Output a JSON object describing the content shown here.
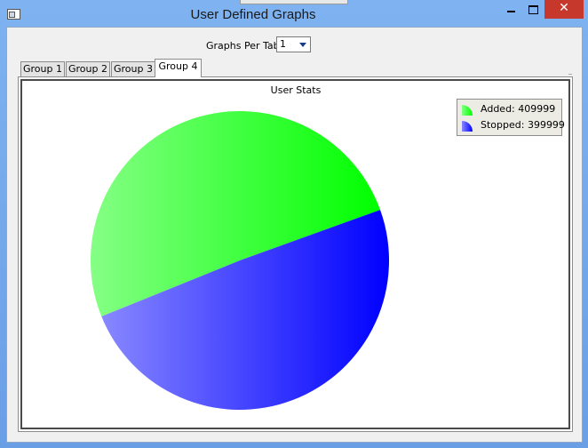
{
  "window": {
    "title": "User Defined Graphs",
    "close_glyph": "✕",
    "icons": {
      "app": "window-app-icon",
      "minimize": "minimize-icon",
      "maximize": "maximize-icon",
      "close": "close-icon"
    }
  },
  "controls": {
    "graphs_per_tab_label": "Graphs Per Tab",
    "graphs_per_tab_value": "1"
  },
  "tabs": [
    {
      "label": "Group 1",
      "active": false
    },
    {
      "label": "Group 2",
      "active": false
    },
    {
      "label": "Group 3",
      "active": false
    },
    {
      "label": "Group 4",
      "active": true
    }
  ],
  "chart_data": {
    "type": "pie",
    "title": "User Stats",
    "series": [
      {
        "name": "Added",
        "value": 409999,
        "color": "#00ff00"
      },
      {
        "name": "Stopped",
        "value": 399999,
        "color": "#0000ff"
      }
    ],
    "legend": [
      {
        "label": "Added: 409999"
      },
      {
        "label": "Stopped: 399999"
      }
    ],
    "legend_position": "top-right"
  }
}
